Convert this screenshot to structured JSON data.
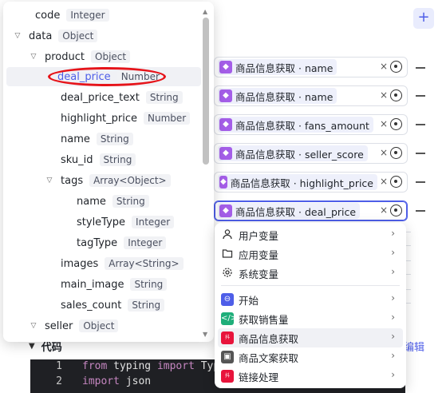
{
  "add_button": "+",
  "variables": [
    {
      "source": "商品信息获取",
      "field": "name"
    },
    {
      "source": "商品信息获取",
      "field": "name"
    },
    {
      "source": "商品信息获取",
      "field": "fans_amount"
    },
    {
      "source": "商品信息获取",
      "field": "seller_score"
    },
    {
      "source": "商品信息获取",
      "field": "highlight_price"
    },
    {
      "source": "商品信息获取",
      "field": "deal_price"
    }
  ],
  "tree": [
    {
      "name": "code",
      "type": "Integer"
    },
    {
      "name": "data",
      "type": "Object"
    },
    {
      "name": "product",
      "type": "Object"
    },
    {
      "name": "deal_price",
      "type": "Number"
    },
    {
      "name": "deal_price_text",
      "type": "String"
    },
    {
      "name": "highlight_price",
      "type": "Number"
    },
    {
      "name": "name",
      "type": "String"
    },
    {
      "name": "sku_id",
      "type": "String"
    },
    {
      "name": "tags",
      "type": "Array<Object>"
    },
    {
      "name": "name",
      "type": "String"
    },
    {
      "name": "styleType",
      "type": "Integer"
    },
    {
      "name": "tagType",
      "type": "Integer"
    },
    {
      "name": "images",
      "type": "Array<String>"
    },
    {
      "name": "main_image",
      "type": "String"
    },
    {
      "name": "sales_count",
      "type": "String"
    },
    {
      "name": "seller",
      "type": "Object"
    }
  ],
  "menu": {
    "groups": [
      {
        "label": "用户变量",
        "icon": "user-icon"
      },
      {
        "label": "应用变量",
        "icon": "folder-icon"
      },
      {
        "label": "系统变量",
        "icon": "gear-icon"
      }
    ],
    "nodes": [
      {
        "label": "开始",
        "icon": "start-icon",
        "color": "#4e5ee8"
      },
      {
        "label": "获取销售量",
        "icon": "code-icon",
        "color": "#1fae7a"
      },
      {
        "label": "商品信息获取",
        "icon": "tiktok-mall-icon",
        "color": "#e8143c"
      },
      {
        "label": "商品文案获取",
        "icon": "image-icon",
        "color": "#555"
      },
      {
        "label": "链接处理",
        "icon": "tiktok-mall-icon",
        "color": "#e8143c"
      }
    ]
  },
  "code_section": {
    "title": "代码",
    "edit_label": "编辑",
    "lines": [
      {
        "num": "1",
        "kw1": "from",
        "mid": " typing ",
        "kw2": "import",
        "rest": " Typ"
      },
      {
        "num": "2",
        "kw1": "import",
        "mid": " json",
        "kw2": "",
        "rest": ""
      }
    ]
  },
  "colors": {
    "accent": "#4e5ee8",
    "cube": "#a45ee8",
    "highlight": "#e6141a"
  }
}
